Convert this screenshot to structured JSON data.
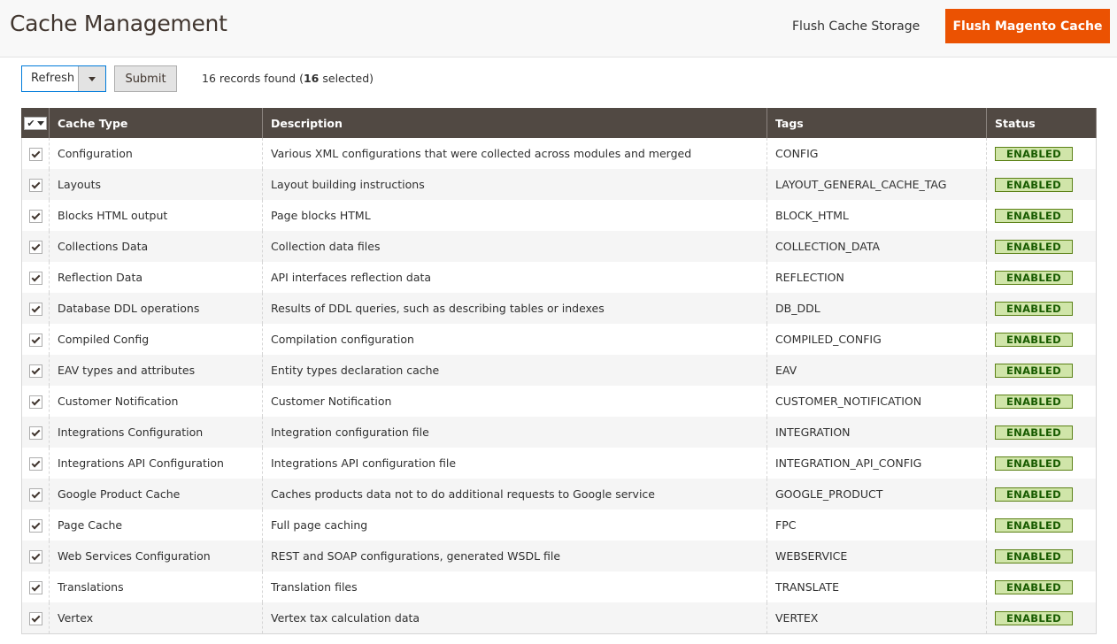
{
  "header": {
    "title": "Cache Management",
    "flush_cache_storage_label": "Flush Cache Storage",
    "flush_magento_cache_label": "Flush Magento Cache"
  },
  "toolbar": {
    "action_select_value": "Refresh",
    "submit_label": "Submit",
    "records_found_prefix": "16 records found (",
    "selected_count": "16",
    "selected_suffix": " selected)"
  },
  "table": {
    "columns": [
      "Cache Type",
      "Description",
      "Tags",
      "Status"
    ],
    "rows": [
      {
        "checked": true,
        "type": "Configuration",
        "description": "Various XML configurations that were collected across modules and merged",
        "tags": "CONFIG",
        "status": "ENABLED"
      },
      {
        "checked": true,
        "type": "Layouts",
        "description": "Layout building instructions",
        "tags": "LAYOUT_GENERAL_CACHE_TAG",
        "status": "ENABLED"
      },
      {
        "checked": true,
        "type": "Blocks HTML output",
        "description": "Page blocks HTML",
        "tags": "BLOCK_HTML",
        "status": "ENABLED"
      },
      {
        "checked": true,
        "type": "Collections Data",
        "description": "Collection data files",
        "tags": "COLLECTION_DATA",
        "status": "ENABLED"
      },
      {
        "checked": true,
        "type": "Reflection Data",
        "description": "API interfaces reflection data",
        "tags": "REFLECTION",
        "status": "ENABLED"
      },
      {
        "checked": true,
        "type": "Database DDL operations",
        "description": "Results of DDL queries, such as describing tables or indexes",
        "tags": "DB_DDL",
        "status": "ENABLED"
      },
      {
        "checked": true,
        "type": "Compiled Config",
        "description": "Compilation configuration",
        "tags": "COMPILED_CONFIG",
        "status": "ENABLED"
      },
      {
        "checked": true,
        "type": "EAV types and attributes",
        "description": "Entity types declaration cache",
        "tags": "EAV",
        "status": "ENABLED"
      },
      {
        "checked": true,
        "type": "Customer Notification",
        "description": "Customer Notification",
        "tags": "CUSTOMER_NOTIFICATION",
        "status": "ENABLED"
      },
      {
        "checked": true,
        "type": "Integrations Configuration",
        "description": "Integration configuration file",
        "tags": "INTEGRATION",
        "status": "ENABLED"
      },
      {
        "checked": true,
        "type": "Integrations API Configuration",
        "description": "Integrations API configuration file",
        "tags": "INTEGRATION_API_CONFIG",
        "status": "ENABLED"
      },
      {
        "checked": true,
        "type": "Google Product Cache",
        "description": "Caches products data not to do additional requests to Google service",
        "tags": "GOOGLE_PRODUCT",
        "status": "ENABLED"
      },
      {
        "checked": true,
        "type": "Page Cache",
        "description": "Full page caching",
        "tags": "FPC",
        "status": "ENABLED"
      },
      {
        "checked": true,
        "type": "Web Services Configuration",
        "description": "REST and SOAP configurations, generated WSDL file",
        "tags": "WEBSERVICE",
        "status": "ENABLED"
      },
      {
        "checked": true,
        "type": "Translations",
        "description": "Translation files",
        "tags": "TRANSLATE",
        "status": "ENABLED"
      },
      {
        "checked": true,
        "type": "Vertex",
        "description": "Vertex tax calculation data",
        "tags": "VERTEX",
        "status": "ENABLED"
      }
    ]
  },
  "colors": {
    "accent": "#eb5202",
    "header_bg": "#514943",
    "status_bg": "#d0e5a9",
    "status_text": "#185b00"
  }
}
